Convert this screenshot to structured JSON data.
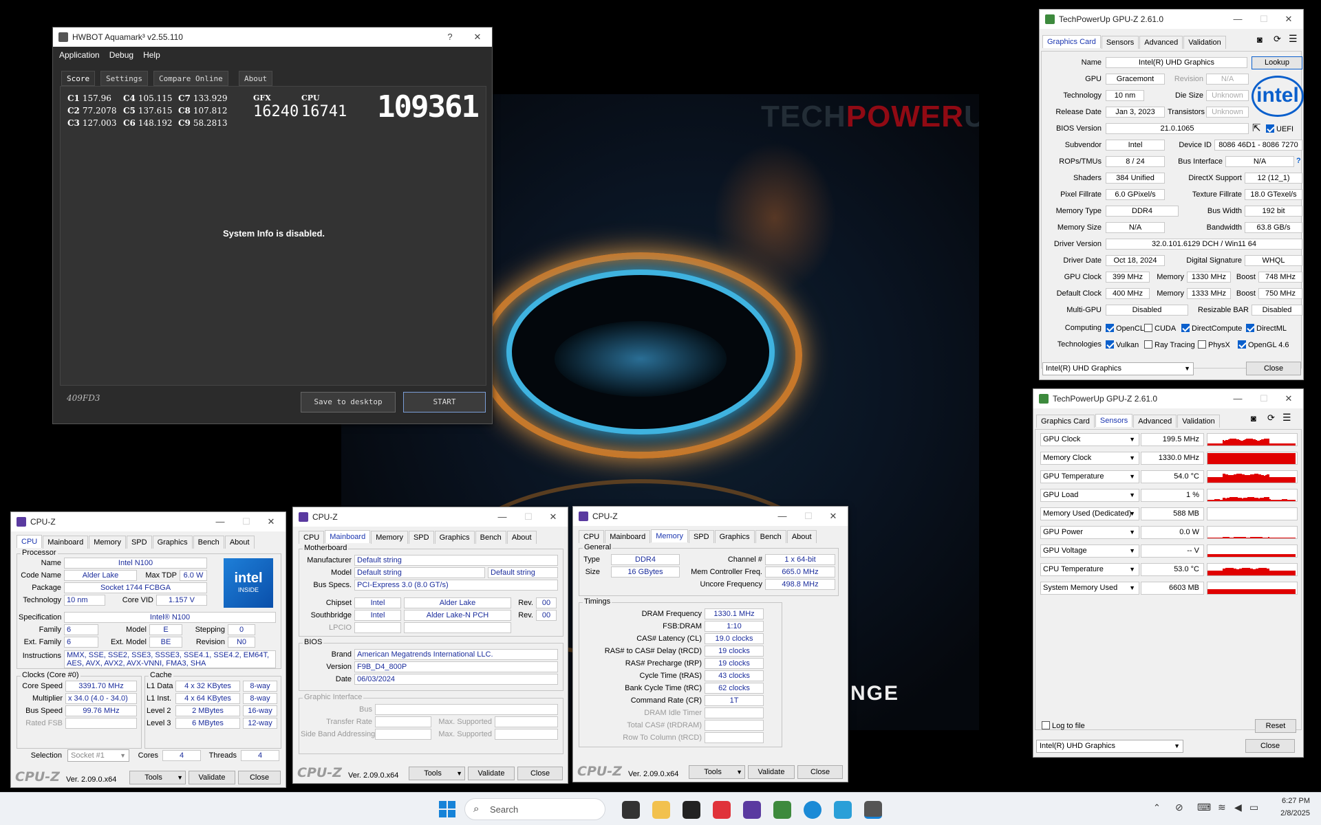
{
  "wallpaper": {
    "logo_a": "TECH",
    "logo_b": "POWER",
    "logo_c": "UP",
    "tag": "NGE"
  },
  "aquamark": {
    "title": "HWBOT Aquamark³ v2.55.110",
    "title_help": "?",
    "menu": [
      "Application",
      "Debug",
      "Help"
    ],
    "tabs": [
      "Score",
      "Settings",
      "Compare Online",
      "About"
    ],
    "scores": [
      {
        "k": "C1",
        "v": "157.96"
      },
      {
        "k": "C2",
        "v": "77.2078"
      },
      {
        "k": "C3",
        "v": "127.003"
      },
      {
        "k": "C4",
        "v": "105.115"
      },
      {
        "k": "C5",
        "v": "137.615"
      },
      {
        "k": "C6",
        "v": "148.192"
      },
      {
        "k": "C7",
        "v": "133.929"
      },
      {
        "k": "C8",
        "v": "107.812"
      },
      {
        "k": "C9",
        "v": "58.2813"
      }
    ],
    "gfx_label": "GFX",
    "gfx_value": "16240",
    "cpu_label": "CPU",
    "cpu_value": "16741",
    "total": "109361",
    "sysinfo": "System Info is disabled.",
    "hash": "409FD3",
    "save_btn": "Save to desktop",
    "start_btn": "START"
  },
  "gpuz1": {
    "title": "TechPowerUp GPU-Z 2.61.0",
    "tabs": [
      "Graphics Card",
      "Sensors",
      "Advanced",
      "Validation"
    ],
    "name_l": "Name",
    "name": "Intel(R) UHD Graphics",
    "lookup": "Lookup",
    "gpu_l": "GPU",
    "gpu": "Gracemont",
    "rev_l": "Revision",
    "rev": "N/A",
    "tech_l": "Technology",
    "tech": "10 nm",
    "die_l": "Die Size",
    "die": "Unknown",
    "rel_l": "Release Date",
    "rel": "Jan 3, 2023",
    "tr_l": "Transistors",
    "tr": "Unknown",
    "bios_l": "BIOS Version",
    "bios": "21.0.1065",
    "uefi": "UEFI",
    "sub_l": "Subvendor",
    "sub": "Intel",
    "dev_l": "Device ID",
    "dev": "8086 46D1 - 8086 7270",
    "rops_l": "ROPs/TMUs",
    "rops": "8 / 24",
    "bus_l": "Bus Interface",
    "bus": "N/A",
    "q": "?",
    "sh_l": "Shaders",
    "sh": "384 Unified",
    "dx_l": "DirectX Support",
    "dx": "12 (12_1)",
    "pf_l": "Pixel Fillrate",
    "pf": "6.0 GPixel/s",
    "tf_l": "Texture Fillrate",
    "tf": "18.0 GTexel/s",
    "mt_l": "Memory Type",
    "mt": "DDR4",
    "bw_l": "Bus Width",
    "bw": "192 bit",
    "ms_l": "Memory Size",
    "ms": "N/A",
    "band_l": "Bandwidth",
    "band": "63.8 GB/s",
    "dv_l": "Driver Version",
    "dv": "32.0.101.6129 DCH / Win11 64",
    "dd_l": "Driver Date",
    "dd": "Oct 18, 2024",
    "ds_l": "Digital Signature",
    "ds": "WHQL",
    "gc_l": "GPU Clock",
    "gc": "399 MHz",
    "mem_l": "Memory",
    "gcm": "1330 MHz",
    "boost_l": "Boost",
    "gcb": "748 MHz",
    "dc_l": "Default Clock",
    "dc": "400 MHz",
    "dcm": "1333 MHz",
    "dcb": "750 MHz",
    "mg_l": "Multi-GPU",
    "mg": "Disabled",
    "rb_l": "Resizable BAR",
    "rb": "Disabled",
    "comp_l": "Computing",
    "tech2_l": "Technologies",
    "computing": [
      "OpenCL",
      "CUDA",
      "DirectCompute",
      "DirectML"
    ],
    "technologies": [
      "Vulkan",
      "Ray Tracing",
      "PhysX",
      "OpenGL 4.6"
    ],
    "select": "Intel(R) UHD Graphics",
    "close": "Close",
    "intel": "intel"
  },
  "gpuz2": {
    "title": "TechPowerUp GPU-Z 2.61.0",
    "tabs": [
      "Graphics Card",
      "Sensors",
      "Advanced",
      "Validation"
    ],
    "sensors": [
      {
        "n": "GPU Clock",
        "v": "199.5 MHz"
      },
      {
        "n": "Memory Clock",
        "v": "1330.0 MHz"
      },
      {
        "n": "GPU Temperature",
        "v": "54.0 °C"
      },
      {
        "n": "GPU Load",
        "v": "1 %"
      },
      {
        "n": "Memory Used (Dedicated)",
        "v": "588 MB"
      },
      {
        "n": "GPU Power",
        "v": "0.0 W"
      },
      {
        "n": "GPU Voltage",
        "v": "-- V"
      },
      {
        "n": "CPU Temperature",
        "v": "53.0 °C"
      },
      {
        "n": "System Memory Used",
        "v": "6603 MB"
      }
    ],
    "log": "Log to file",
    "reset": "Reset",
    "select": "Intel(R) UHD Graphics",
    "close": "Close"
  },
  "cpuz1": {
    "title": "CPU-Z",
    "tabs": [
      "CPU",
      "Mainboard",
      "Memory",
      "SPD",
      "Graphics",
      "Bench",
      "About"
    ],
    "proc": "Processor",
    "name_l": "Name",
    "name": "Intel N100",
    "code_l": "Code Name",
    "code": "Alder Lake",
    "tdp_l": "Max TDP",
    "tdp": "6.0 W",
    "pkg_l": "Package",
    "pkg": "Socket 1744 FCBGA",
    "tech_l": "Technology",
    "tech": "10 nm",
    "vid_l": "Core VID",
    "vid": "1.157 V",
    "spec_l": "Specification",
    "spec": "Intel® N100",
    "fam_l": "Family",
    "fam": "6",
    "mod_l": "Model",
    "mod": "E",
    "step_l": "Stepping",
    "step": "0",
    "efam_l": "Ext. Family",
    "efam": "6",
    "emod_l": "Ext. Model",
    "emod": "BE",
    "rev_l": "Revision",
    "rev": "N0",
    "ins_l": "Instructions",
    "ins": "MMX, SSE, SSE2, SSE3, SSSE3, SSE4.1, SSE4.2, EM64T, AES, AVX, AVX2, AVX-VNNI, FMA3, SHA",
    "clocks": "Clocks (Core #0)",
    "cache": "Cache",
    "cs_l": "Core Speed",
    "cs": "3391.70 MHz",
    "mul_l": "Multiplier",
    "mul": "x 34.0 (4.0 - 34.0)",
    "bs_l": "Bus Speed",
    "bs": "99.76 MHz",
    "fsb_l": "Rated FSB",
    "l1d_l": "L1 Data",
    "l1d": "4 x 32 KBytes",
    "l1d_w": "8-way",
    "l1i_l": "L1 Inst.",
    "l1i": "4 x 64 KBytes",
    "l1i_w": "8-way",
    "l2_l": "Level 2",
    "l2": "2 MBytes",
    "l2_w": "16-way",
    "l3_l": "Level 3",
    "l3": "6 MBytes",
    "l3_w": "12-way",
    "sel_l": "Selection",
    "sel": "Socket #1",
    "cores_l": "Cores",
    "cores": "4",
    "thr_l": "Threads",
    "thr": "4",
    "brand": "CPU-Z",
    "ver": "Ver. 2.09.0.x64",
    "tools": "Tools",
    "validate": "Validate",
    "close": "Close",
    "badge_a": "intel",
    "badge_b": "INSIDE"
  },
  "cpuz2": {
    "title": "CPU-Z",
    "tabs": [
      "CPU",
      "Mainboard",
      "Memory",
      "SPD",
      "Graphics",
      "Bench",
      "About"
    ],
    "mb": "Motherboard",
    "man_l": "Manufacturer",
    "man": "Default string",
    "mod_l": "Model",
    "mod": "Default string",
    "mod2": "Default string",
    "bus_l": "Bus Specs.",
    "bus": "PCI-Express 3.0 (8.0 GT/s)",
    "chip_l": "Chipset",
    "chip": "Intel",
    "chip2": "Alder Lake",
    "rev_l": "Rev.",
    "chip_rev": "00",
    "sb_l": "Southbridge",
    "sb": "Intel",
    "sb2": "Alder Lake-N PCH",
    "sb_rev": "00",
    "lpc_l": "LPCIO",
    "bios": "BIOS",
    "brand_l": "Brand",
    "brand": "American Megatrends International LLC.",
    "ver_l": "Version",
    "ver": "F9B_D4_800P",
    "date_l": "Date",
    "date": "06/03/2024",
    "gi": "Graphic Interface",
    "gbus_l": "Bus",
    "tr_l": "Transfer Rate",
    "ms_l": "Max. Supported",
    "sba_l": "Side Band Addressing",
    "ms2_l": "Max. Supported",
    "logo": "CPU-Z",
    "version": "Ver. 2.09.0.x64",
    "tools": "Tools",
    "validate": "Validate",
    "close": "Close"
  },
  "cpuz3": {
    "title": "CPU-Z",
    "tabs": [
      "CPU",
      "Mainboard",
      "Memory",
      "SPD",
      "Graphics",
      "Bench",
      "About"
    ],
    "gen": "General",
    "type_l": "Type",
    "type": "DDR4",
    "ch_l": "Channel #",
    "ch": "1 x 64-bit",
    "size_l": "Size",
    "size": "16 GBytes",
    "mcf_l": "Mem Controller Freq.",
    "mcf": "665.0 MHz",
    "unc_l": "Uncore Frequency",
    "unc": "498.8 MHz",
    "tim": "Timings",
    "timings": [
      {
        "l": "DRAM Frequency",
        "v": "1330.1 MHz"
      },
      {
        "l": "FSB:DRAM",
        "v": "1:10"
      },
      {
        "l": "CAS# Latency (CL)",
        "v": "19.0 clocks"
      },
      {
        "l": "RAS# to CAS# Delay (tRCD)",
        "v": "19 clocks"
      },
      {
        "l": "RAS# Precharge (tRP)",
        "v": "19 clocks"
      },
      {
        "l": "Cycle Time (tRAS)",
        "v": "43 clocks"
      },
      {
        "l": "Bank Cycle Time (tRC)",
        "v": "62 clocks"
      },
      {
        "l": "Command Rate (CR)",
        "v": "1T"
      },
      {
        "l": "DRAM Idle Timer",
        "v": ""
      },
      {
        "l": "Total CAS# (tRDRAM)",
        "v": ""
      },
      {
        "l": "Row To Column (tRCD)",
        "v": ""
      }
    ],
    "logo": "CPU-Z",
    "version": "Ver. 2.09.0.x64",
    "tools": "Tools",
    "validate": "Validate",
    "close": "Close"
  },
  "taskbar": {
    "search": "Search",
    "time": "6:27 PM",
    "date": "2/8/2025"
  }
}
